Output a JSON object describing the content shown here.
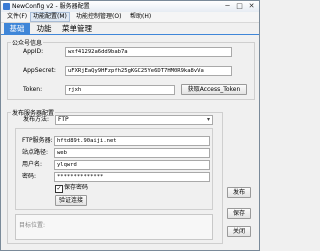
{
  "window": {
    "title": "NewConfig v2 - 服务器配置",
    "minimize": "─",
    "maximize": "□",
    "close": "✕"
  },
  "menu": [
    {
      "label": "文件(F)"
    },
    {
      "label": "功能配置(M)"
    },
    {
      "label": "功能控制管理(O)"
    },
    {
      "label": "帮助(H)"
    }
  ],
  "tabs": [
    {
      "label": "基础"
    },
    {
      "label": "功能"
    },
    {
      "label": "菜单管理"
    }
  ],
  "account": {
    "group_title": "公众号信息",
    "appid_label": "AppID:",
    "appid_value": "wxf41292a6dd9bab7a",
    "appsecret_label": "AppSecret:",
    "appsecret_value": "uFXRjEaQy9HFzpfh25gKGC25Ye6DT7HM0R9ka8vVa",
    "token_label": "Token:",
    "token_value": "rjxh",
    "get_token_button": "获取Access_Token"
  },
  "publish": {
    "group_title": "发布服务器配置",
    "method_label": "发布方法:",
    "method_value": "FTP",
    "ftp_server_label": "FTP服务器:",
    "ftp_server_value": "hftd89t.90aiji.net",
    "site_path_label": "站点路径:",
    "site_path_value": "web",
    "username_label": "用户名:",
    "username_value": "ylqwrd",
    "password_label": "密码:",
    "password_value": "**************",
    "save_password_label": "保存密码",
    "save_password_checked": true,
    "test_button": "验证连接",
    "dir_label": "目标位置:"
  },
  "actions": {
    "publish": "发布",
    "save": "保存",
    "close": "关闭"
  }
}
